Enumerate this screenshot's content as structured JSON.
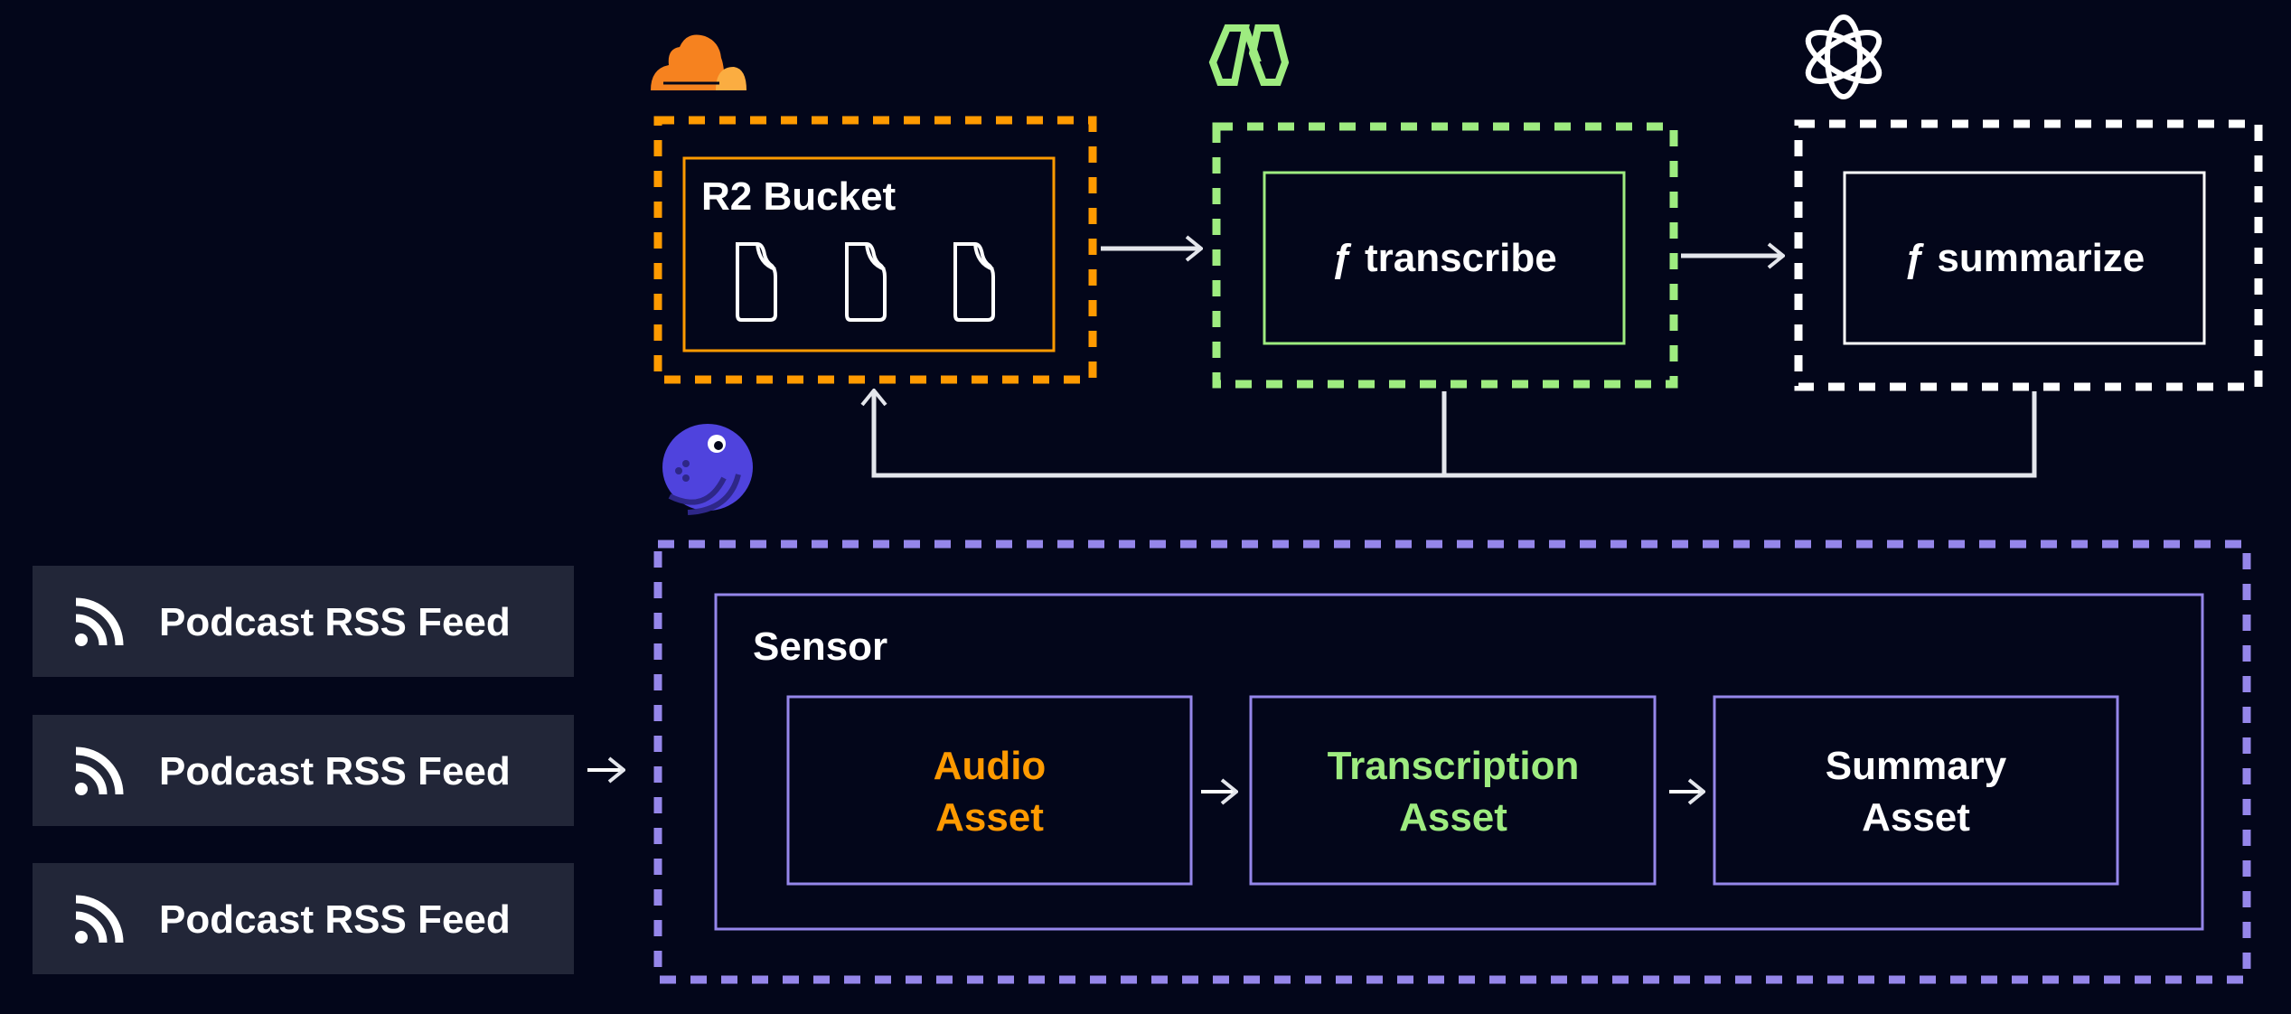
{
  "colors": {
    "background": "#03061a",
    "cloudflare_orange": "#ff9a00",
    "modal_green": "#9eec80",
    "openai_white": "#ffffff",
    "dagster_purple": "#9586ea",
    "feed_box": "#222638",
    "arrow": "#e4e6ec"
  },
  "icons": {
    "cloudflare": "cloudflare-logo-icon",
    "modal": "modal-logo-icon",
    "openai": "openai-logo-icon",
    "dagster": "dagster-octopus-icon",
    "file": "file-icon",
    "rss": "rss-icon"
  },
  "r2": {
    "title": "R2 Bucket"
  },
  "transcribe": {
    "label": "ƒ transcribe"
  },
  "summarize": {
    "label": "ƒ summarize"
  },
  "feeds": [
    {
      "label": "Podcast RSS Feed"
    },
    {
      "label": "Podcast RSS Feed"
    },
    {
      "label": "Podcast RSS Feed"
    }
  ],
  "sensor": {
    "title": "Sensor",
    "assets": [
      {
        "line1": "Audio",
        "line2": "Asset",
        "color": "#ff9a00"
      },
      {
        "line1": "Transcription",
        "line2": "Asset",
        "color": "#9eec80"
      },
      {
        "line1": "Summary",
        "line2": "Asset",
        "color": "#ffffff"
      }
    ]
  }
}
